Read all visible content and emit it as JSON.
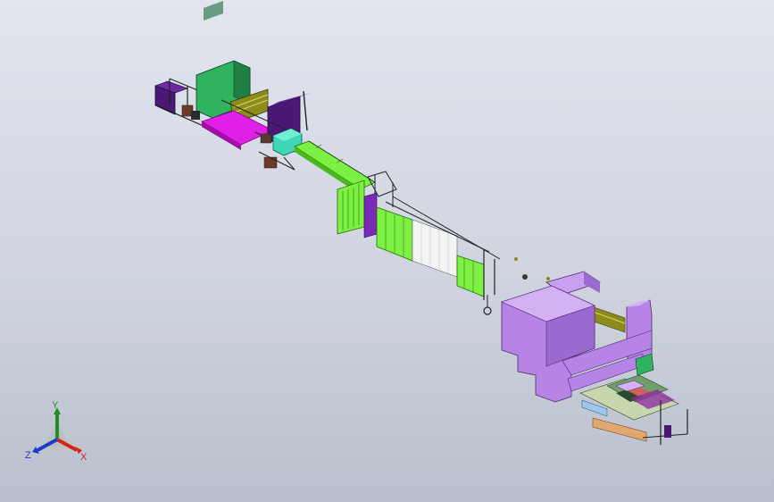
{
  "viewport": {
    "background_top": "#e2e5ee",
    "background_bottom": "#b9bfcc"
  },
  "model": {
    "colors": {
      "magenta": "#e020e6",
      "dark_purple": "#4b1878",
      "green": "#2fb35f",
      "lime": "#7cf043",
      "cyan": "#3fd7b8",
      "olive": "#8c8c1c",
      "lavender": "#b784e6",
      "violet": "#7a2ab6",
      "white_panel": "#f4f4f4",
      "frame": "#222222"
    },
    "icons": [
      "reference-triad-icon"
    ]
  },
  "triad": {
    "x_label": "X",
    "y_label": "Y",
    "z_label": "Z",
    "x_color": "#d0241c",
    "y_color": "#1f8f2a",
    "z_color": "#1c3cc8"
  }
}
